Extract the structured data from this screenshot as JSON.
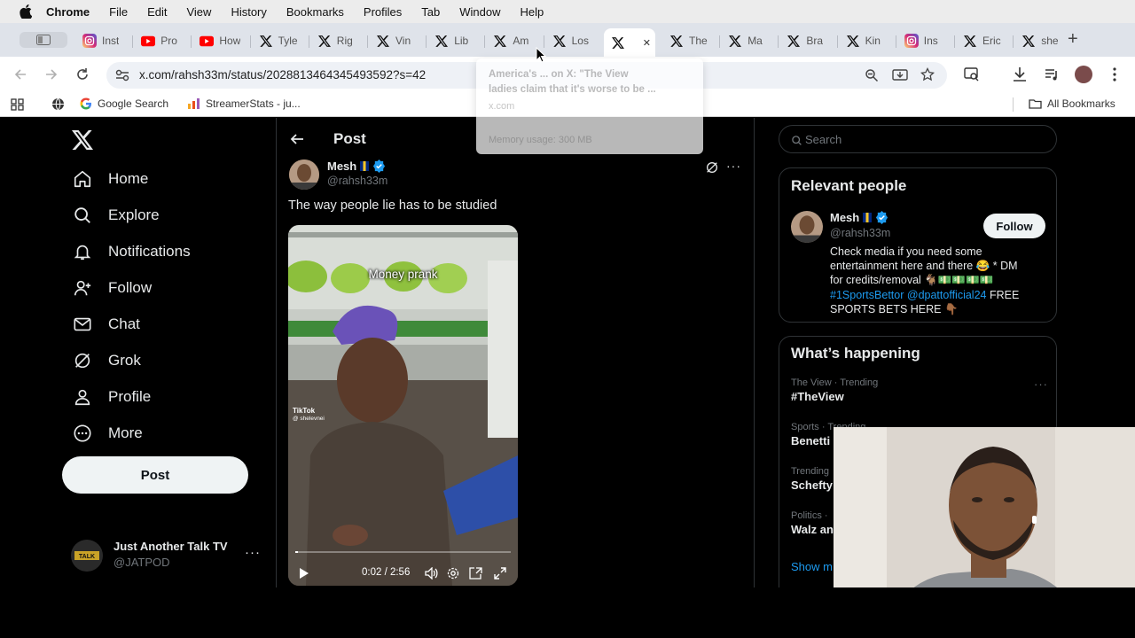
{
  "menubar": {
    "items": [
      "Chrome",
      "File",
      "Edit",
      "View",
      "History",
      "Bookmarks",
      "Profiles",
      "Tab",
      "Window",
      "Help"
    ]
  },
  "tabs": [
    {
      "label": "Inst",
      "icon": "instagram-icon"
    },
    {
      "label": "Pro",
      "icon": "youtube-icon"
    },
    {
      "label": "How",
      "icon": "youtube-icon"
    },
    {
      "label": "Tyle",
      "icon": "x-logo-icon"
    },
    {
      "label": "Rig",
      "icon": "x-logo-icon"
    },
    {
      "label": "Vin",
      "icon": "x-logo-icon"
    },
    {
      "label": "Lib",
      "icon": "x-logo-icon"
    },
    {
      "label": "Am",
      "icon": "x-logo-icon"
    },
    {
      "label": "Los",
      "icon": "x-logo-icon"
    },
    {
      "label": "",
      "icon": "x-logo-icon",
      "active": true
    },
    {
      "label": "The",
      "icon": "x-logo-icon"
    },
    {
      "label": "Ma",
      "icon": "x-logo-icon"
    },
    {
      "label": "Bra",
      "icon": "x-logo-icon"
    },
    {
      "label": "Kin",
      "icon": "x-logo-icon"
    },
    {
      "label": "Ins",
      "icon": "instagram-icon"
    },
    {
      "label": "Eric",
      "icon": "x-logo-icon"
    },
    {
      "label": "she",
      "icon": "x-logo-icon"
    }
  ],
  "toolbar": {
    "url": "x.com/rahsh33m/status/202881346434549359​2?s=42"
  },
  "bookmarks": {
    "items": [
      "Google Search",
      "StreamerStats - ju..."
    ],
    "all_label": "All Bookmarks"
  },
  "tooltip": {
    "line1": "America's ... on X: \"The View",
    "line2": "ladies claim that it's worse to be ...",
    "line3": "x.com",
    "memory": "Memory usage: 300 MB"
  },
  "sidebar": {
    "items": [
      {
        "label": "Home",
        "icon": "home-icon"
      },
      {
        "label": "Explore",
        "icon": "search-icon"
      },
      {
        "label": "Notifications",
        "icon": "bell-icon"
      },
      {
        "label": "Follow",
        "icon": "follow-icon"
      },
      {
        "label": "Chat",
        "icon": "mail-icon"
      },
      {
        "label": "Grok",
        "icon": "grok-icon"
      },
      {
        "label": "Profile",
        "icon": "person-icon"
      },
      {
        "label": "More",
        "icon": "more-circle-icon"
      }
    ],
    "post_label": "Post",
    "account_name": "Just Another Talk TV",
    "account_handle": "@JATPOD"
  },
  "main": {
    "header": "Post",
    "author_name": "Mesh",
    "author_handle": "@rahsh33m",
    "text": "The way people lie has to be studied",
    "video_caption": "Money prank",
    "video_watermark": "TikTok",
    "video_watermark_handle": "@ shelevnei",
    "video_time": "0:02 / 2:56",
    "progress": 0.012
  },
  "right": {
    "search_placeholder": "Search",
    "relevant_title": "Relevant people",
    "person_name": "Mesh",
    "person_handle": "@rahsh33m",
    "follow_label": "Follow",
    "bio_line1": "Check media if you need some",
    "bio_line2": "entertainment here and there 😂 * DM",
    "bio_line3": "for credits/removal 🐐💵💵💵💵",
    "bio_tag1": "#1SportsBettor",
    "bio_tag2": "@dpattofficial24",
    "bio_line4": "FREE",
    "bio_line5": "SPORTS BETS HERE 👇🏾",
    "happening_title": "What’s happening",
    "trends": [
      {
        "meta": "The View · Trending",
        "title": "#TheView"
      },
      {
        "meta": "Sports · Trending",
        "title": "Benetti"
      },
      {
        "meta": "Trending",
        "title": "Schefty"
      },
      {
        "meta": "Politics ·",
        "title": "Walz an"
      }
    ],
    "show_more": "Show m"
  },
  "colors": {
    "accent": "#1d9bf0",
    "verified": "#1d9bf0"
  }
}
